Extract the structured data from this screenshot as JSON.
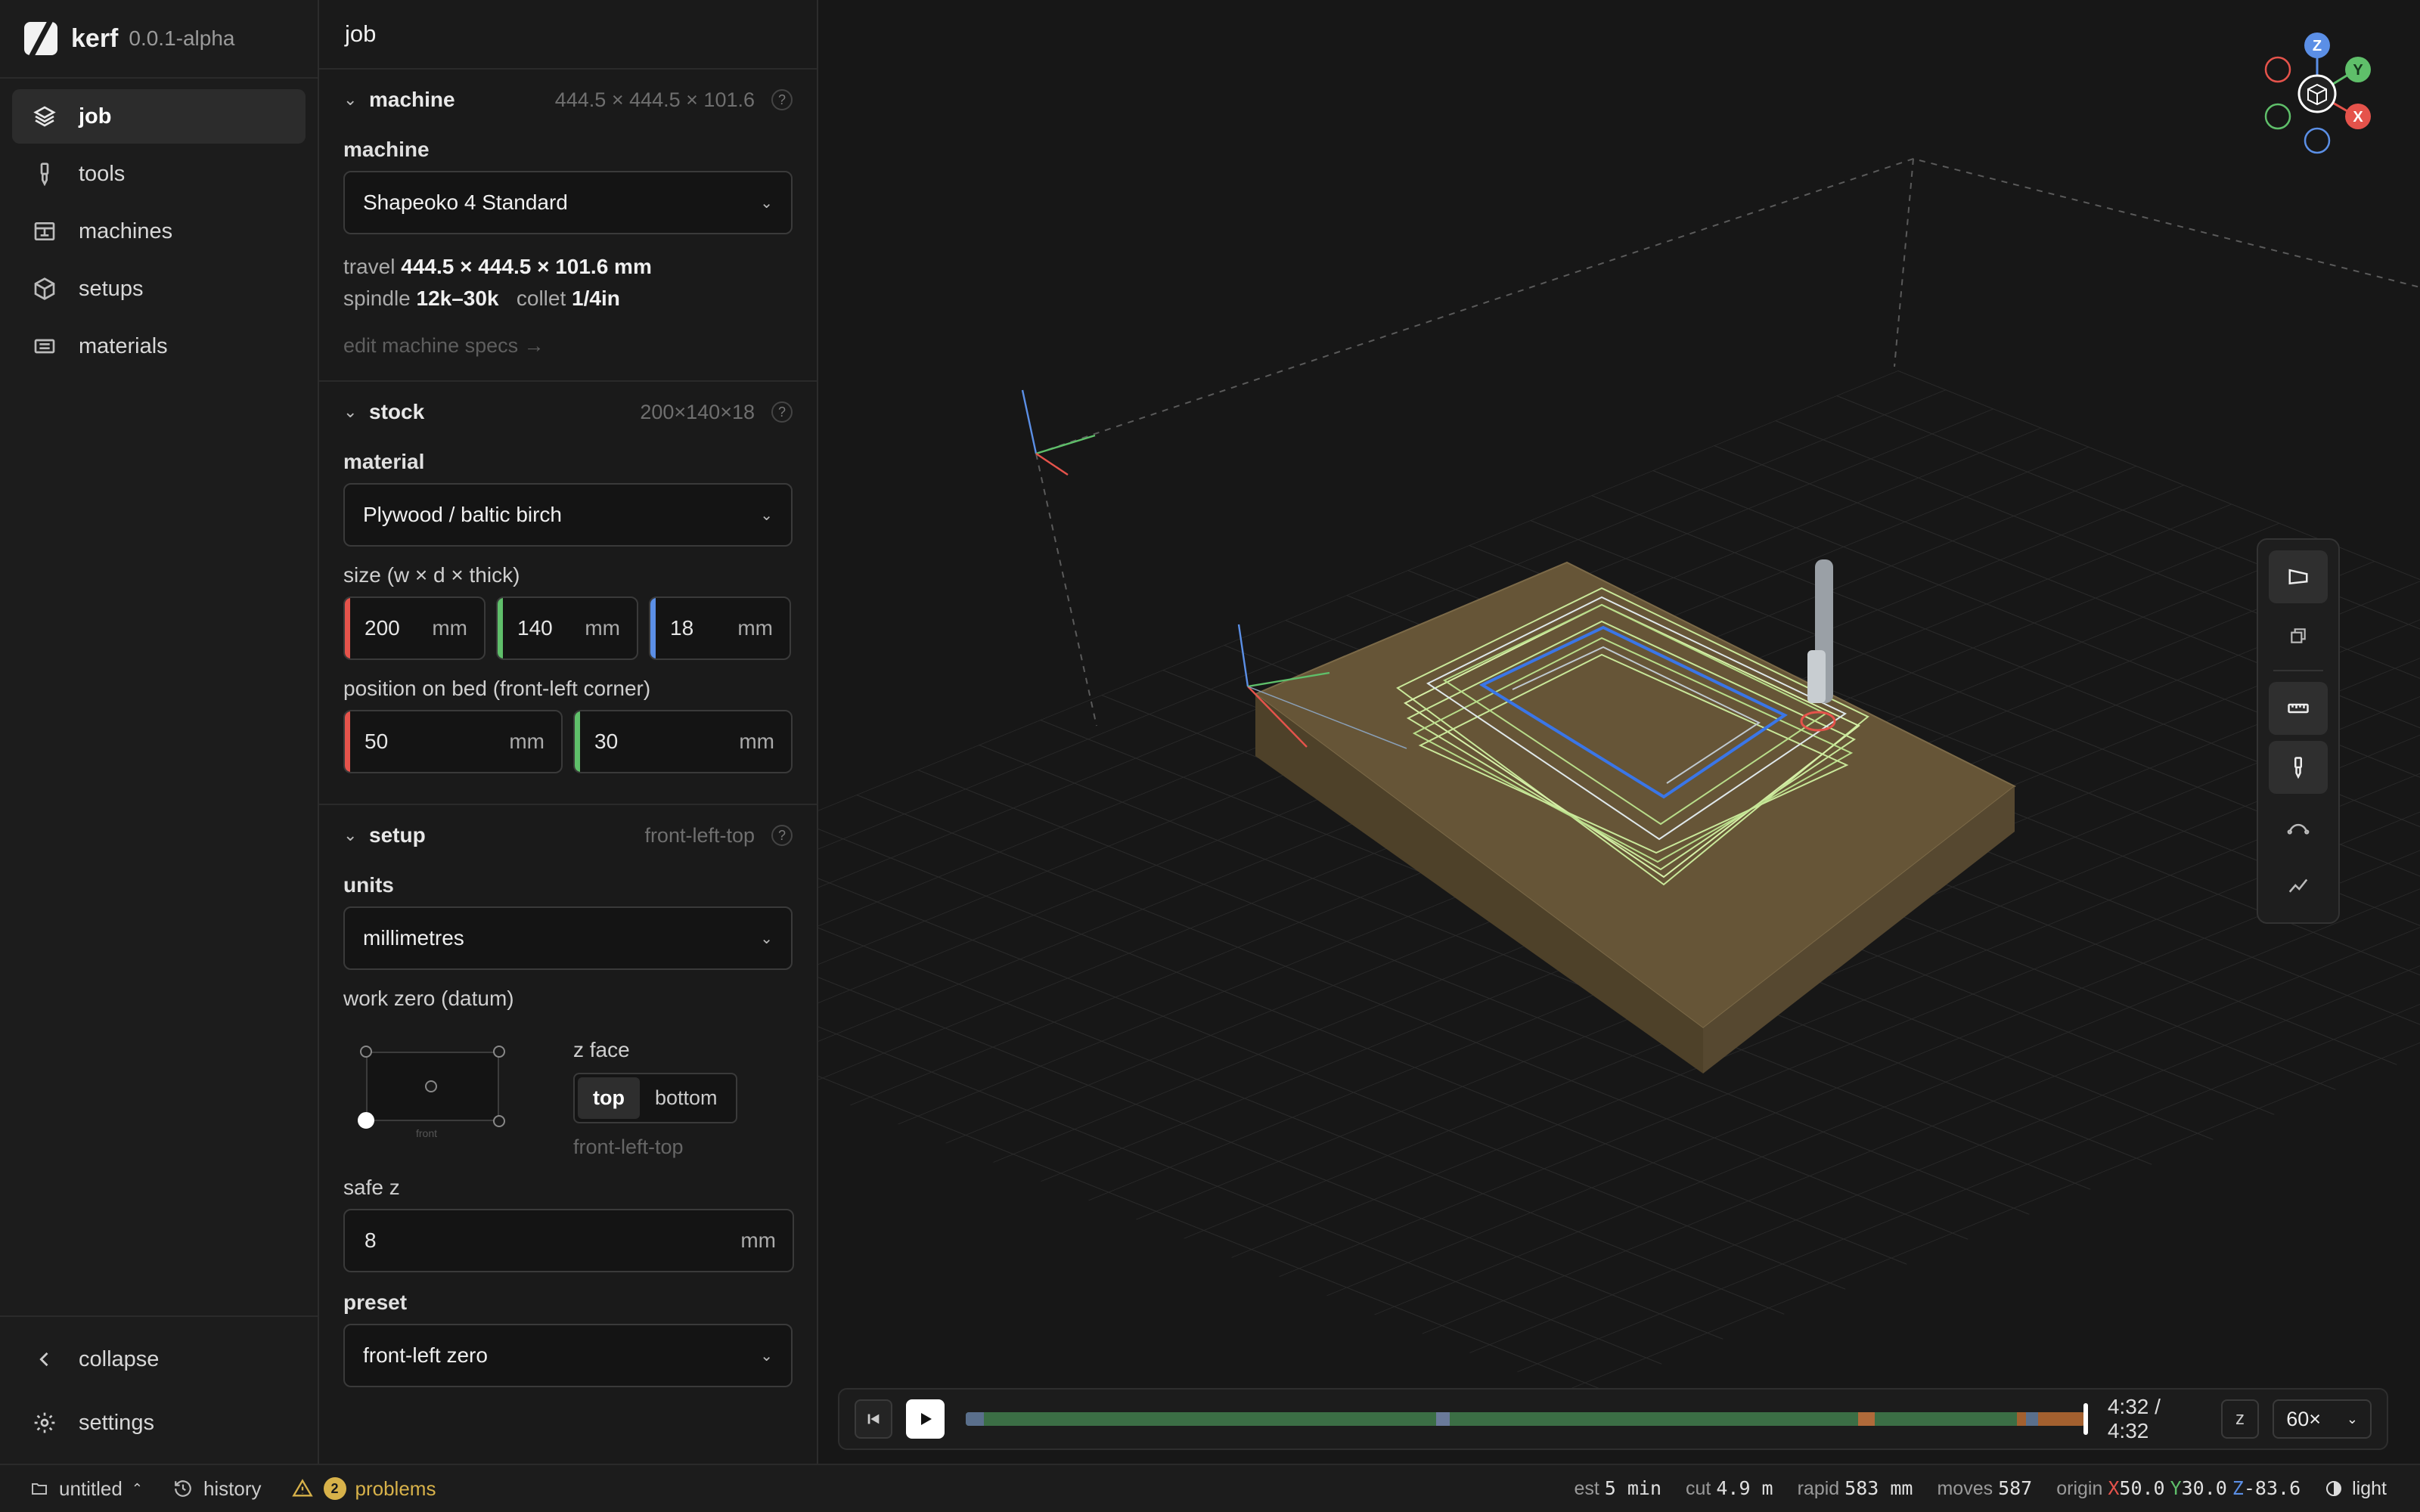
{
  "app": {
    "name": "kerf",
    "version": "0.0.1-alpha"
  },
  "nav": {
    "items": [
      {
        "label": "job",
        "icon": "layers-icon",
        "active": true
      },
      {
        "label": "tools",
        "icon": "endmill-icon"
      },
      {
        "label": "machines",
        "icon": "machine-icon"
      },
      {
        "label": "setups",
        "icon": "cube-icon"
      },
      {
        "label": "materials",
        "icon": "material-icon"
      }
    ],
    "collapse": "collapse",
    "settings": "settings"
  },
  "panel": {
    "title": "job",
    "machine": {
      "header": "machine",
      "dims": "444.5 × 444.5 × 101.6",
      "label": "machine",
      "selected": "Shapeoko 4 Standard",
      "travel_label": "travel",
      "travel_value": "444.5 × 444.5 × 101.6 mm",
      "spindle_label": "spindle",
      "spindle_value": "12k–30k",
      "collet_label": "collet",
      "collet_value": "1/4in",
      "edit_link": "edit machine specs →"
    },
    "stock": {
      "header": "stock",
      "dims": "200×140×18",
      "material_label": "material",
      "material": "Plywood / baltic birch",
      "size_label": "size (w × d × thick)",
      "w": "200",
      "d": "140",
      "t": "18",
      "unit": "mm",
      "position_label": "position on bed (front-left corner)",
      "px": "50",
      "py": "30"
    },
    "setup": {
      "header": "setup",
      "meta": "front-left-top",
      "units_label": "units",
      "units": "millimetres",
      "work_zero_label": "work zero (datum)",
      "front_label": "front",
      "zface_label": "z face",
      "zface_top": "top",
      "zface_bottom": "bottom",
      "zface_selected": "top",
      "datum_value": "front-left-top",
      "safe_z_label": "safe z",
      "safe_z": "8",
      "preset_label": "preset",
      "preset": "front-left zero"
    }
  },
  "viewport": {
    "gizmo": {
      "z": "Z",
      "y": "Y",
      "x": "X"
    },
    "playback": {
      "time": "4:32 / 4:32",
      "z_toggle": "z",
      "speed": "60×",
      "progress": 1.0
    }
  },
  "status": {
    "file": "untitled",
    "history": "history",
    "problems_count": "2",
    "problems": "problems",
    "est_label": "est",
    "est_value": "5 min",
    "cut_label": "cut",
    "cut_value": "4.9 m",
    "rapid_label": "rapid",
    "rapid_value": "583 mm",
    "moves_label": "moves",
    "moves_value": "587",
    "origin_label": "origin",
    "origin_x_label": "X",
    "origin_x": "50.0",
    "origin_y_label": "Y",
    "origin_y": "30.0",
    "origin_z_label": "Z",
    "origin_z": "-83.6",
    "theme": "light"
  },
  "colors": {
    "x_axis": "#e5534b",
    "y_axis": "#5fbf6a",
    "z_axis": "#5b8fe6",
    "warning": "#d8b24a",
    "stock": "#6b5a3d"
  }
}
